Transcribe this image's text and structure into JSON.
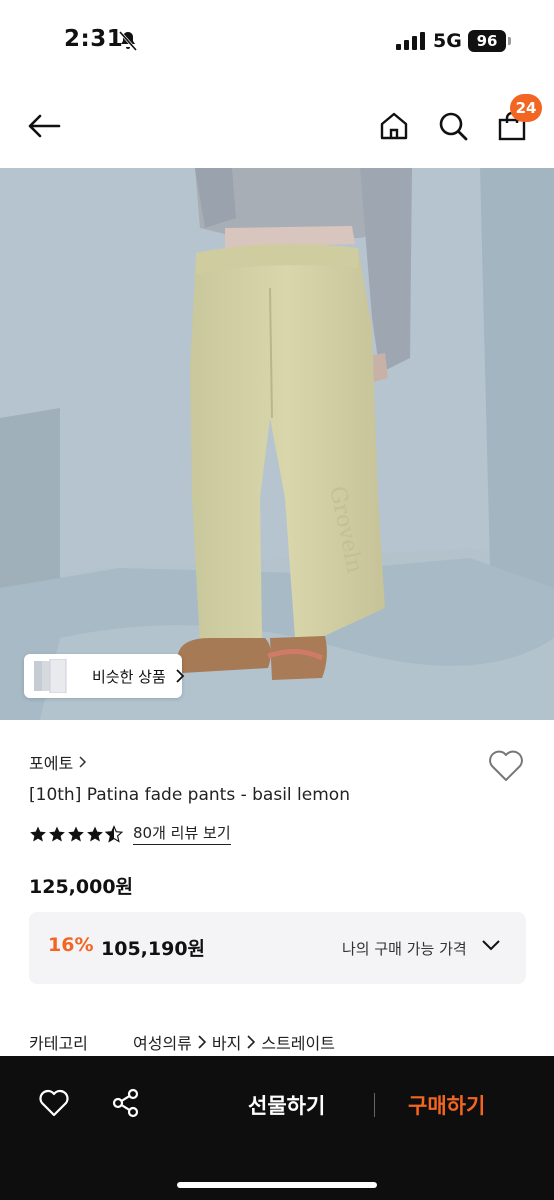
{
  "status_bar": {
    "time": "2:31",
    "network": "5G",
    "battery": "96",
    "icons": [
      "bell-slash-icon",
      "signal-icon"
    ]
  },
  "header": {
    "icons": [
      "back-arrow-icon",
      "home-icon",
      "search-icon",
      "shopping-bag-icon"
    ],
    "cart_badge": "24"
  },
  "gallery": {
    "similar_button_label": "비슷한 상품"
  },
  "product": {
    "brand": "포에토",
    "title": "[10th] Patina fade pants - basil lemon",
    "rating": 4.5,
    "review_link": "80개 리뷰 보기",
    "price": "125,000원",
    "discount_rate": "16%",
    "discount_price": "105,190원",
    "my_price_label": "나의 구매 가능 가격"
  },
  "category": {
    "label": "카테고리",
    "path": [
      "여성의류",
      "바지",
      "스트레이트"
    ]
  },
  "bottom_bar": {
    "gift_label": "선물하기",
    "buy_label": "구매하기"
  },
  "colors": {
    "accent": "#f26522",
    "bottom_bar_bg": "#0e0e0e",
    "price_box_bg": "#f4f4f6"
  }
}
